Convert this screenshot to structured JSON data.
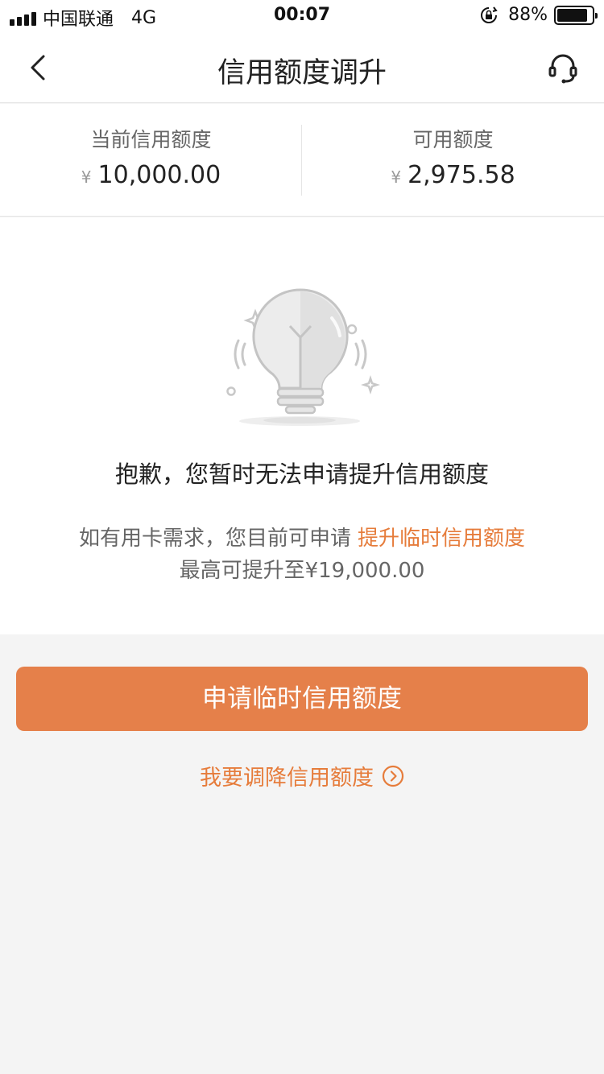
{
  "status_bar": {
    "carrier": "中国联通",
    "network": "4G",
    "time": "00:07",
    "battery_percent": "88%",
    "battery_level": 0.88
  },
  "nav": {
    "title": "信用额度调升",
    "back_icon": "chevron-left-icon",
    "service_icon": "headset-icon"
  },
  "credit": {
    "current_label": "当前信用额度",
    "current_currency": "¥",
    "current_value": "10,000.00",
    "available_label": "可用额度",
    "available_currency": "¥",
    "available_value": "2,975.58"
  },
  "notice": {
    "illustration_icon": "lightbulb-icon",
    "title": "抱歉，您暂时无法申请提升信用额度",
    "line1_text": "如有用卡需求，您目前可申请",
    "line1_link": "提升临时信用额度",
    "line2_text": "最高可提升至¥19,000.00"
  },
  "actions": {
    "primary_label": "申请临时信用额度",
    "secondary_label": "我要调降信用额度",
    "secondary_icon": "chevron-right-circle-icon"
  },
  "colors": {
    "accent": "#e5804a",
    "link": "#e67c3b",
    "background": "#f4f4f4"
  }
}
